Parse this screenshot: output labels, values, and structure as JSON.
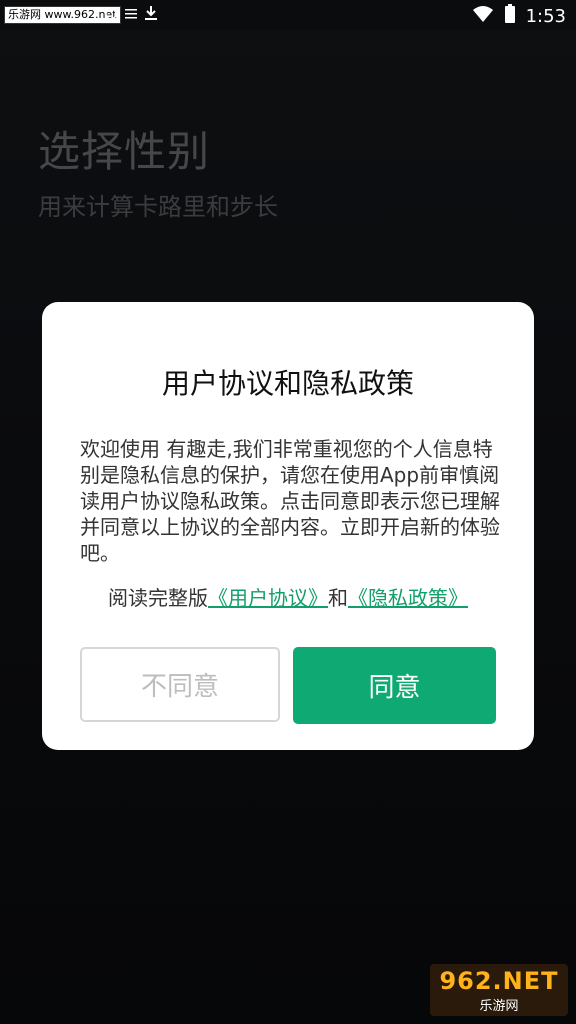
{
  "status_bar": {
    "watermark": "乐游网 www.962.net",
    "time": "1:53",
    "icons": [
      "notification-icon",
      "menu-icon",
      "download-icon",
      "wifi-icon",
      "battery-icon"
    ]
  },
  "page": {
    "title": "选择性别",
    "subtitle": "用来计算卡路里和步长"
  },
  "dialog": {
    "title": "用户协议和隐私政策",
    "body": "欢迎使用 有趣走,我们非常重视您的个人信息特别是隐私信息的保护，请您在使用App前审慎阅读用户协议隐私政策。点击同意即表示您已理解并同意以上协议的全部内容。立即开启新的体验吧。",
    "links_prefix": "阅读完整版",
    "user_agreement_link": "《用户协议》",
    "links_conjunction": "和",
    "privacy_policy_link": "《隐私政策》",
    "disagree_label": "不同意",
    "agree_label": "同意"
  },
  "watermark_bottom": {
    "logo": "962.NET",
    "sub": "乐游网"
  },
  "colors": {
    "accent": "#0faa73",
    "link": "#12a06a",
    "background": "#0d0f12"
  }
}
